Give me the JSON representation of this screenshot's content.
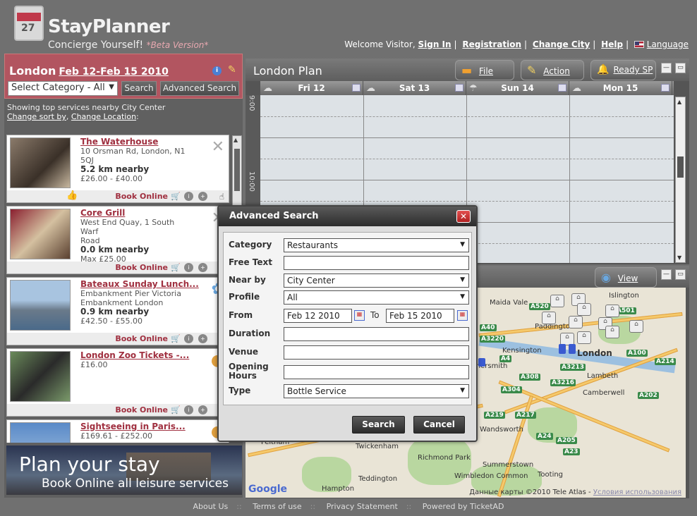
{
  "brand": {
    "title": "StayPlanner",
    "tagline": "Concierge Yourself!",
    "beta": "*Beta Version*",
    "calendar_num": "27"
  },
  "topnav": {
    "welcome": "Welcome Visitor,",
    "sign_in": "Sign In",
    "registration": "Registration",
    "change_city": "Change City",
    "help": "Help",
    "language": "Language"
  },
  "city": {
    "name": "London",
    "dates": "Feb 12-Feb 15 2010"
  },
  "filter": {
    "category": "Select Category - All",
    "search": "Search",
    "advanced": "Advanced Search"
  },
  "info": {
    "line1": "Showing top services nearby City Center",
    "sort": "Change sort by",
    "location": "Change Location"
  },
  "listings": [
    {
      "name": "The Waterhouse",
      "addr1": "10 Orsman Rd, London, N1",
      "addr2": "5QJ",
      "distance": "5.2 km nearby",
      "price": "£26.00 - £40.00",
      "book": "Book Online"
    },
    {
      "name": "Core Grill",
      "addr1": "West End Quay, 1 South Warf",
      "addr2": "Road",
      "distance": "0.0 km nearby",
      "price": "Max £25.00",
      "book": "Book Online"
    },
    {
      "name": "Bateaux Sunday Lunch...",
      "addr1": "Embankment Pier Victoria",
      "addr2": "Embankment London",
      "distance": "0.9 km nearby",
      "price": "£42.50 - £55.00",
      "book": "Book Online"
    },
    {
      "name": "London Zoo Tickets -...",
      "addr1": "£16.00",
      "addr2": "",
      "distance": "",
      "price": "",
      "book": "Book Online"
    },
    {
      "name": "Sightseeing in Paris...",
      "addr1": "£169.61 - £252.00",
      "addr2": "",
      "distance": "",
      "price": "",
      "book": ""
    }
  ],
  "banner": {
    "line1": "Plan your stay",
    "line2": "Book Online all leisure services"
  },
  "plan": {
    "title": "London Plan",
    "file": "File",
    "action": "Action",
    "ready": "Ready SP",
    "days": [
      "Fri 12",
      "Sat 13",
      "Sun 14",
      "Mon 15"
    ],
    "time1": "9:00",
    "time2": "10:00"
  },
  "map": {
    "view": "View",
    "copyright": "Данные карты ©2010 Tele Atlas -",
    "terms": "Условия использования",
    "google": "Google",
    "places": [
      "Islington",
      "Maida Vale",
      "Paddington",
      "Kensington",
      "London",
      "Hammersmith",
      "Lambeth",
      "Camberwell",
      "Wandsworth",
      "Richmond Park",
      "Twickenham",
      "Feltham",
      "Summerstown",
      "Tooting",
      "Wimbledon Common",
      "Teddington",
      "Hampton"
    ],
    "roads": [
      "A520",
      "A501",
      "A40",
      "A3220",
      "A4",
      "A3213",
      "A3216",
      "A308",
      "A304",
      "A219",
      "A217",
      "A24",
      "A205",
      "A23",
      "A202",
      "A100",
      "A214"
    ]
  },
  "modal": {
    "title": "Advanced Search",
    "category_label": "Category",
    "category_value": "Restaurants",
    "freetext_label": "Free Text",
    "freetext_value": "",
    "near_label": "Near by",
    "near_value": "City Center",
    "profile_label": "Profile",
    "profile_value": "All",
    "from_label": "From",
    "from_value": "Feb 12 2010",
    "to_label": "To",
    "to_value": "Feb 15 2010",
    "duration_label": "Duration",
    "duration_value": "",
    "venue_label": "Venue",
    "venue_value": "",
    "opening_label": "Opening Hours",
    "opening_value": "",
    "type_label": "Type",
    "type_value": "Bottle Service",
    "search_btn": "Search",
    "cancel_btn": "Cancel"
  },
  "footer": {
    "about": "About Us",
    "terms": "Terms of use",
    "privacy": "Privacy Statement",
    "powered": "Powered by TicketAD"
  }
}
